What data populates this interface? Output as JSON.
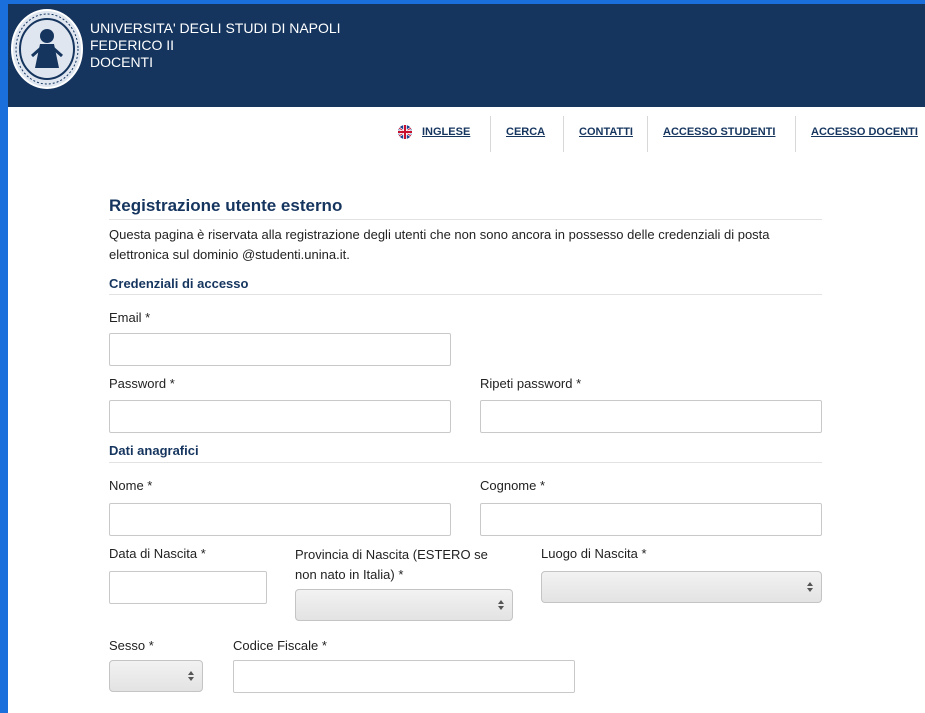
{
  "header": {
    "title_lines": [
      "UNIVERSITA' DEGLI STUDI DI NAPOLI",
      "FEDERICO II",
      "DOCENTI"
    ],
    "logo": "university-seal",
    "bg_color": "#15355f"
  },
  "nav": {
    "items": [
      {
        "label": "INGLESE",
        "icon": "uk-flag-icon"
      },
      {
        "label": "CERCA"
      },
      {
        "label": "CONTATTI"
      },
      {
        "label": "ACCESSO STUDENTI"
      },
      {
        "label": "ACCESSO DOCENTI"
      }
    ]
  },
  "form": {
    "title": "Registrazione utente esterno",
    "intro": "Questa pagina è riservata alla registrazione degli utenti che non sono ancora in possesso delle credenziali di posta elettronica sul dominio @studenti.unina.it.",
    "section_credentials": "Credenziali di accesso",
    "section_personal": "Dati anagrafici",
    "labels": {
      "email": "Email *",
      "password": "Password *",
      "repeat_password": "Ripeti password *",
      "first_name": "Nome *",
      "last_name": "Cognome *",
      "birth_date": "Data di Nascita *",
      "birth_province": "Provincia di Nascita (ESTERO se non nato in Italia) *",
      "birth_place": "Luogo di Nascita *",
      "sex": "Sesso *",
      "tax_code": "Codice Fiscale *"
    },
    "values": {
      "email": "",
      "password": "",
      "repeat_password": "",
      "first_name": "",
      "last_name": "",
      "birth_date": "",
      "birth_province": "",
      "birth_place": "",
      "sex": "",
      "tax_code": ""
    }
  },
  "colors": {
    "accent": "#15355f",
    "frame": "#1a6fdc"
  }
}
